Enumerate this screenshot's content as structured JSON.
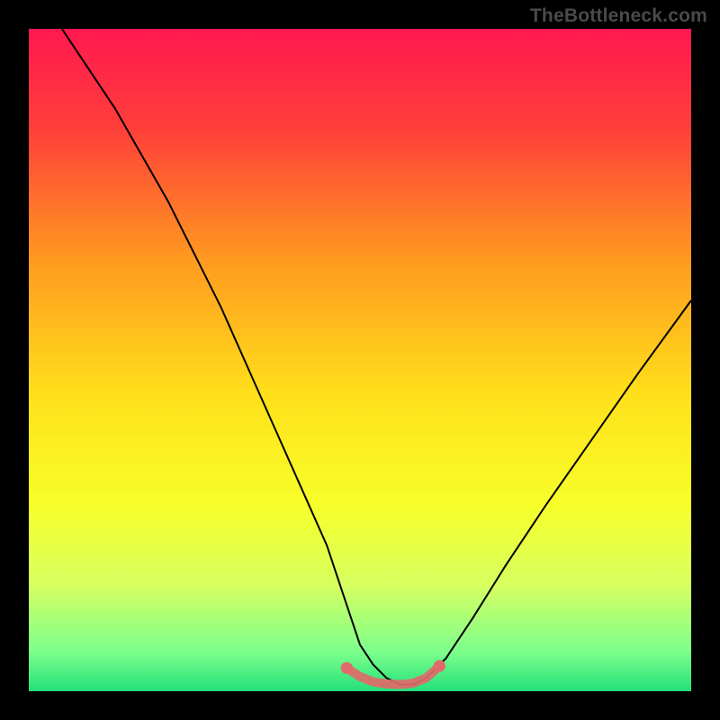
{
  "watermark": "TheBottleneck.com",
  "chart_data": {
    "type": "line",
    "title": "",
    "xlabel": "",
    "ylabel": "",
    "xlim": [
      0,
      100
    ],
    "ylim": [
      0,
      100
    ],
    "gradient_stops": [
      {
        "offset": 0,
        "color": "#ff1850"
      },
      {
        "offset": 0.15,
        "color": "#ff3e3a"
      },
      {
        "offset": 0.35,
        "color": "#ff9a1f"
      },
      {
        "offset": 0.55,
        "color": "#ffdf1a"
      },
      {
        "offset": 0.72,
        "color": "#f7ff2a"
      },
      {
        "offset": 0.84,
        "color": "#d6ff60"
      },
      {
        "offset": 0.94,
        "color": "#7dff8c"
      },
      {
        "offset": 1.0,
        "color": "#24e07a"
      }
    ],
    "series": [
      {
        "name": "curve",
        "color": "#000000",
        "x": [
          5,
          9,
          13,
          17,
          21,
          25,
          29,
          33,
          37,
          41,
          45,
          48,
          50,
          52,
          54,
          56,
          58,
          60,
          63,
          67,
          72,
          78,
          85,
          92,
          100
        ],
        "y": [
          100,
          94,
          88,
          81,
          74,
          66,
          58,
          49,
          40,
          31,
          22,
          13,
          7,
          4,
          2,
          1,
          1,
          2,
          5,
          11,
          19,
          28,
          38,
          48,
          59
        ]
      },
      {
        "name": "highlight-band",
        "color": "#e06b6b",
        "x": [
          48,
          50,
          52,
          54,
          56,
          58,
          60,
          62
        ],
        "y": [
          3.5,
          2.2,
          1.4,
          1.1,
          1.0,
          1.2,
          2.0,
          3.8
        ]
      }
    ]
  }
}
